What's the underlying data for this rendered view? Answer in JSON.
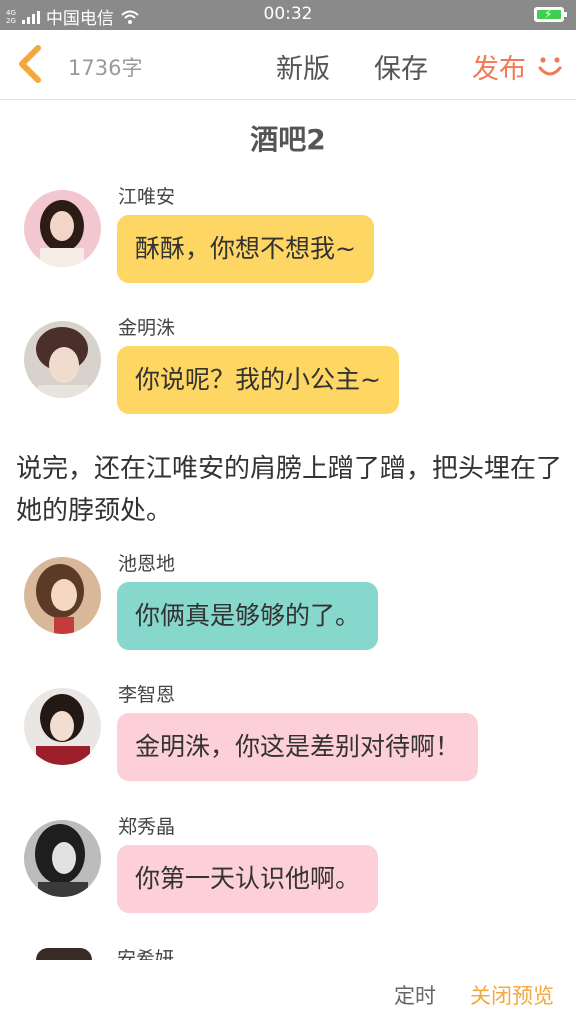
{
  "status_bar": {
    "network_small": "4G\n2G",
    "carrier": "中国电信",
    "time": "00:32"
  },
  "toolbar": {
    "word_count": "1736字",
    "new_version_label": "新版",
    "save_label": "保存",
    "publish_label": "发布"
  },
  "story": {
    "title": "酒吧2",
    "messages": [
      {
        "sender": "江唯安",
        "text": "酥酥，你想不想我~",
        "bubble_color": "#fdd663"
      },
      {
        "sender": "金明洙",
        "text": "你说呢？我的小公主~",
        "bubble_color": "#fdd663"
      },
      {
        "sender": "池恩地",
        "text": "你俩真是够够的了。",
        "bubble_color": "#86d8cc"
      },
      {
        "sender": "李智恩",
        "text": "金明洙，你这是差别对待啊！",
        "bubble_color": "#fdcfd6"
      },
      {
        "sender": "郑秀晶",
        "text": "你第一天认识他啊。",
        "bubble_color": "#fdcfd6"
      }
    ],
    "narration": "说完，还在江唯安的肩膀上蹭了蹭，把头埋在了她的脖颈处。",
    "partial_sender": "安希妍"
  },
  "bottom_bar": {
    "timer_label": "定时",
    "close_preview_label": "关闭预览"
  },
  "colors": {
    "accent_orange": "#f07a55",
    "preview_gold": "#f3a73c",
    "status_bar_bg": "#8a8a8a"
  },
  "icons": {
    "back": "chevron-left-icon",
    "smile": "smile-icon",
    "wifi": "wifi-icon",
    "battery": "battery-charging-icon"
  }
}
